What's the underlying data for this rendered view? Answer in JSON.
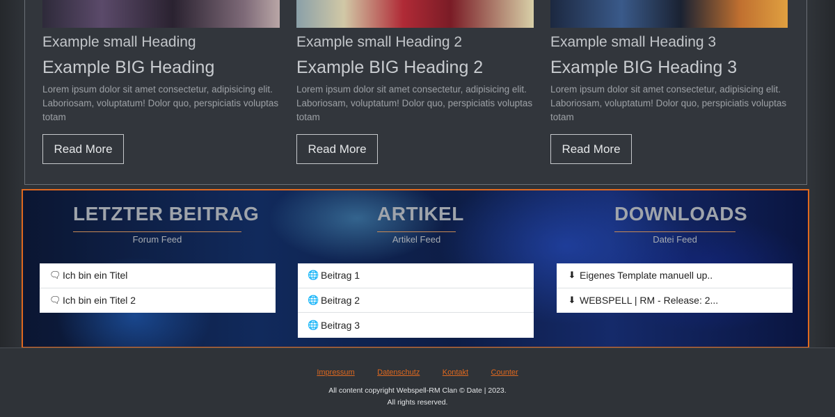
{
  "news": {
    "cards": [
      {
        "small_heading": "Example small Heading",
        "big_heading": "Example BIG Heading",
        "text": "Lorem ipsum dolor sit amet consectetur, adipisicing elit. Laboriosam, voluptatum! Dolor quo, perspiciatis voluptas totam",
        "button": "Read More"
      },
      {
        "small_heading": "Example small Heading 2",
        "big_heading": "Example BIG Heading 2",
        "text": "Lorem ipsum dolor sit amet consectetur, adipisicing elit. Laboriosam, voluptatum! Dolor quo, perspiciatis voluptas totam",
        "button": "Read More"
      },
      {
        "small_heading": "Example small Heading 3",
        "big_heading": "Example BIG Heading 3",
        "text": "Lorem ipsum dolor sit amet consectetur, adipisicing elit. Laboriosam, voluptatum! Dolor quo, perspiciatis voluptas totam",
        "button": "Read More"
      }
    ]
  },
  "feeds": {
    "forum": {
      "title": "LETZTER BEITRAG",
      "subtitle": "Forum Feed",
      "icon": "comments-icon",
      "items": [
        "Ich bin ein Titel",
        "Ich bin ein Titel 2"
      ]
    },
    "articles": {
      "title": "ARTIKEL",
      "subtitle": "Artikel Feed",
      "icon": "globe-icon",
      "items": [
        "Beitrag 1",
        "Beitrag 2",
        "Beitrag 3"
      ]
    },
    "downloads": {
      "title": "DOWNLOADS",
      "subtitle": "Datei Feed",
      "icon": "download-icon",
      "items": [
        "Eigenes Template manuell up..",
        "WEBSPELL | RM - Release: 2..."
      ]
    }
  },
  "footer": {
    "links": [
      "Impressum",
      "Datenschutz",
      "Kontakt",
      "Counter"
    ],
    "copyright": "All content copyright Webspell-RM Clan © Date | 2023.",
    "rights": "All rights reserved."
  },
  "colors": {
    "accent": "#e0691f",
    "background": "#2f3338"
  }
}
